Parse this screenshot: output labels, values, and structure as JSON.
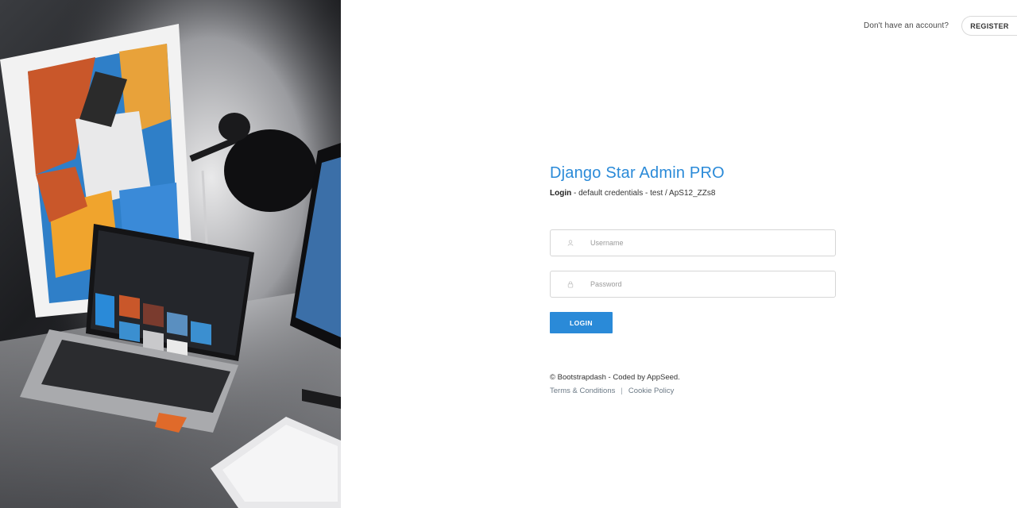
{
  "header": {
    "prompt": "Don't have an account?",
    "register_label": "REGISTER"
  },
  "login": {
    "title": "Django Star Admin PRO",
    "subtitle_bold": "Login",
    "subtitle_rest": " - default credentials - test / ApS12_ZZs8",
    "username_placeholder": "Username",
    "password_placeholder": "Password",
    "submit_label": "LOGIN"
  },
  "footer": {
    "copyright": "© Bootstrapdash - Coded by AppSeed.",
    "terms": "Terms & Conditions",
    "separator": "|",
    "cookie": "Cookie Policy"
  },
  "colors": {
    "accent": "#2a8ad8",
    "text": "#333333",
    "border": "#d6d6d6"
  },
  "icons": {
    "username": "user-icon",
    "password": "lock-icon"
  }
}
